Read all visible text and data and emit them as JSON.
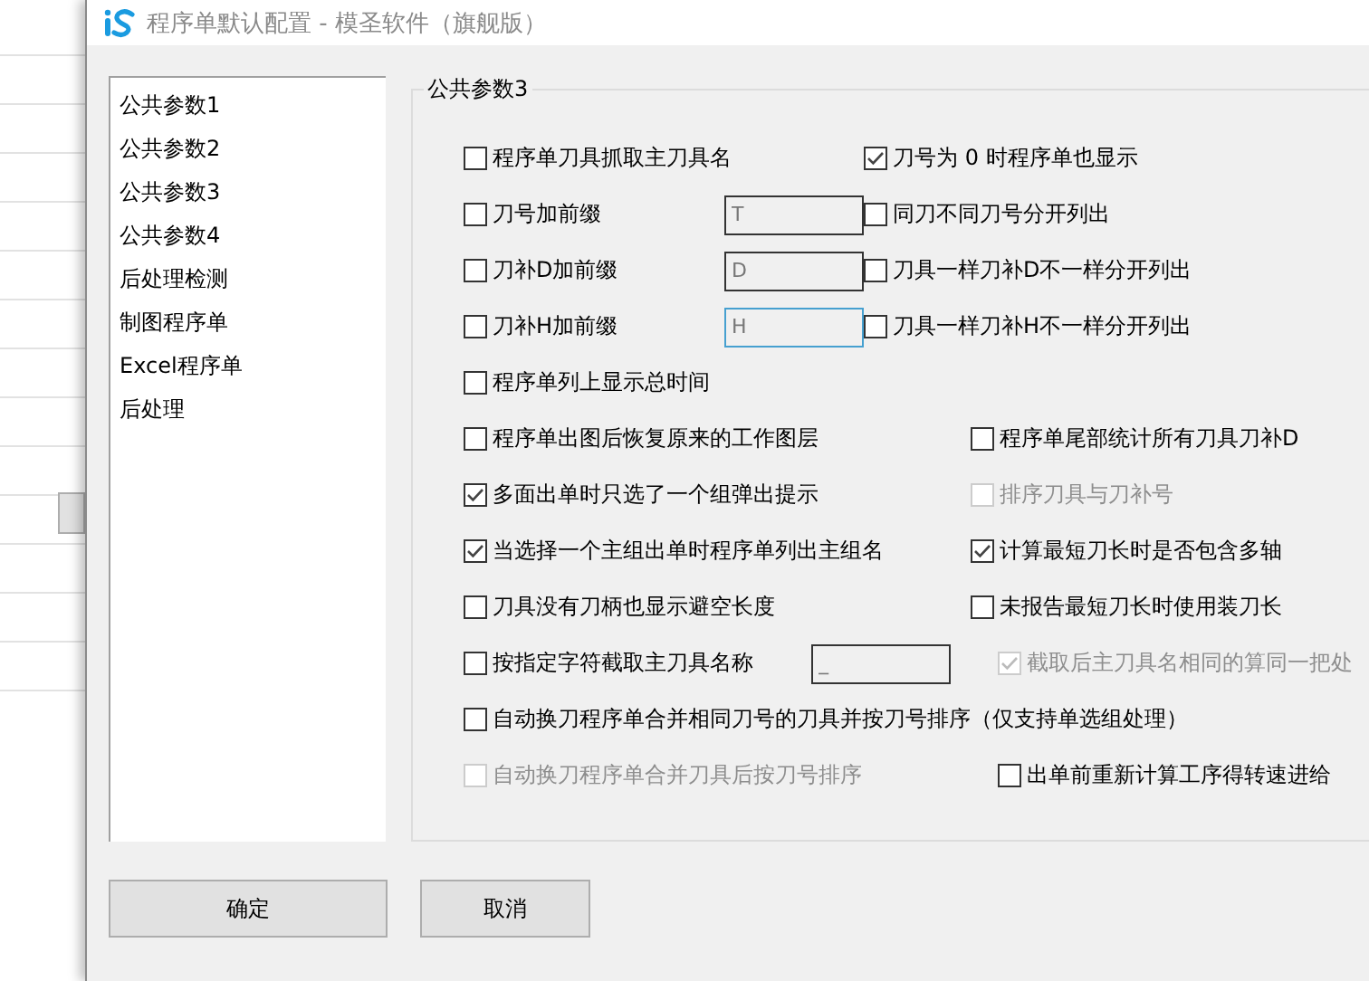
{
  "window": {
    "title": "程序单默认配置 - 模圣软件（旗舰版）"
  },
  "sidebar": {
    "items": [
      {
        "label": "公共参数1",
        "selected": false
      },
      {
        "label": "公共参数2",
        "selected": false
      },
      {
        "label": "公共参数3",
        "selected": false
      },
      {
        "label": "公共参数4",
        "selected": false
      },
      {
        "label": "后处理检测",
        "selected": false
      },
      {
        "label": "制图程序单",
        "selected": false
      },
      {
        "label": "Excel程序单",
        "selected": false
      },
      {
        "label": "后处理",
        "selected": false
      }
    ]
  },
  "group": {
    "title": "公共参数3",
    "rows": [
      {
        "kind": "pair",
        "left": {
          "label": "程序单刀具抓取主刀具名",
          "checked": false,
          "disabled": false
        },
        "right": {
          "label": "刀号为 0 时程序单也显示",
          "checked": true,
          "disabled": false
        }
      },
      {
        "kind": "pair",
        "left": {
          "label": "刀号加前缀",
          "checked": false,
          "disabled": false
        },
        "field": {
          "value": "T",
          "focused": false
        },
        "right": {
          "label": "同刀不同刀号分开列出",
          "checked": false,
          "disabled": false
        }
      },
      {
        "kind": "pair",
        "left": {
          "label": "刀补D加前缀",
          "checked": false,
          "disabled": false
        },
        "field": {
          "value": "D",
          "focused": false
        },
        "right": {
          "label": "刀具一样刀补D不一样分开列出",
          "checked": false,
          "disabled": false
        }
      },
      {
        "kind": "pair",
        "left": {
          "label": "刀补H加前缀",
          "checked": false,
          "disabled": false
        },
        "field": {
          "value": "H",
          "focused": true
        },
        "right": {
          "label": "刀具一样刀补H不一样分开列出",
          "checked": false,
          "disabled": false
        }
      },
      {
        "kind": "single",
        "left": {
          "label": "程序单列上显示总时间",
          "checked": false,
          "disabled": false
        }
      },
      {
        "kind": "wide",
        "left": {
          "label": "程序单出图后恢复原来的工作图层",
          "checked": false,
          "disabled": false
        },
        "right": {
          "label": "程序单尾部统计所有刀具刀补D",
          "checked": false,
          "disabled": false
        }
      },
      {
        "kind": "wide",
        "left": {
          "label": "多面出单时只选了一个组弹出提示",
          "checked": true,
          "disabled": false
        },
        "right": {
          "label": "排序刀具与刀补号",
          "checked": false,
          "disabled": true
        }
      },
      {
        "kind": "wide",
        "left": {
          "label": "当选择一个主组出单时程序单列出主组名",
          "checked": true,
          "disabled": false
        },
        "right": {
          "label": "计算最短刀长时是否包含多轴",
          "checked": true,
          "disabled": false
        }
      },
      {
        "kind": "wide",
        "left": {
          "label": "刀具没有刀柄也显示避空长度",
          "checked": false,
          "disabled": false
        },
        "right": {
          "label": "未报告最短刀长时使用装刀长",
          "checked": false,
          "disabled": false
        }
      },
      {
        "kind": "far",
        "left": {
          "label": "按指定字符截取主刀具名称",
          "checked": false,
          "disabled": false
        },
        "field": {
          "value": "_",
          "focused": false
        },
        "right": {
          "label": "截取后主刀具名相同的算同一把处",
          "checked": true,
          "disabled": true
        }
      },
      {
        "kind": "single",
        "left": {
          "label": "自动换刀程序单合并相同刀号的刀具并按刀号排序（仅支持单选组处理）",
          "checked": false,
          "disabled": false
        }
      },
      {
        "kind": "far",
        "left": {
          "label": "自动换刀程序单合并刀具后按刀号排序",
          "checked": false,
          "disabled": true
        },
        "right": {
          "label": "出单前重新计算工序得转速进给",
          "checked": false,
          "disabled": false
        }
      }
    ]
  },
  "buttons": [
    {
      "label": "确定"
    },
    {
      "label": "取消"
    }
  ]
}
